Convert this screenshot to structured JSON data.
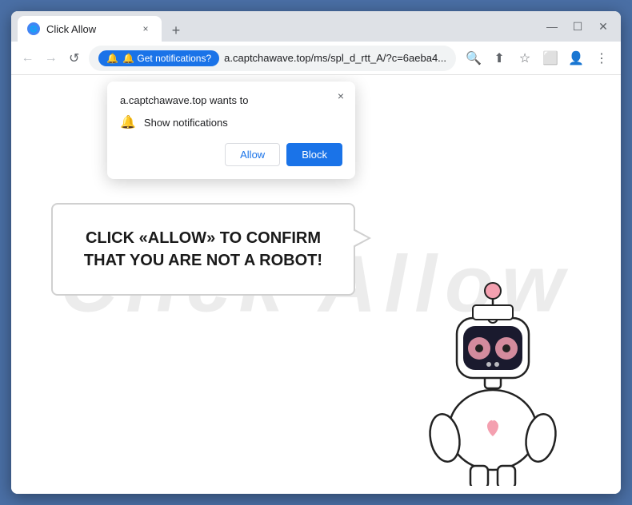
{
  "browser": {
    "tab": {
      "favicon": "🌐",
      "title": "Click Allow",
      "close_label": "×"
    },
    "new_tab_label": "+",
    "window_controls": {
      "minimize": "—",
      "maximize": "☐",
      "close": "✕"
    }
  },
  "toolbar": {
    "back_label": "←",
    "forward_label": "→",
    "reload_label": "↺",
    "notification_btn": "🔔 Get notifications?",
    "address": "a.captchawave.top/ms/spl_d_rtt_A/?c=6aeba4...",
    "search_icon": "🔍",
    "share_icon": "⬆",
    "bookmark_icon": "☆",
    "extend_icon": "⬜",
    "account_icon": "👤",
    "menu_icon": "⋮"
  },
  "popup": {
    "title": "a.captchawave.top wants to",
    "close_label": "×",
    "notification_label": "Show notifications",
    "allow_label": "Allow",
    "block_label": "Block"
  },
  "content": {
    "main_message": "CLICK «ALLOW» TO CONFIRM THAT YOU ARE NOT A ROBOT!",
    "watermark": "Click Allow"
  }
}
